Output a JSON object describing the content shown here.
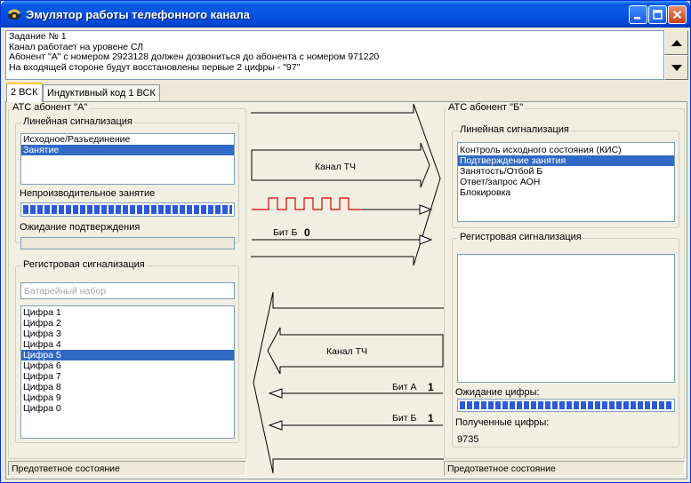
{
  "window": {
    "title": "Эмулятор работы телефонного канала"
  },
  "task": {
    "lines": [
      "Задание № 1",
      "Канал работает на уровене СЛ",
      "Абонент \"А\" с номером 2923128 должен дозвониться до абонента с номером 971220",
      "На входящей стороне будут восстановлены первые 2 цифры - \"97\""
    ]
  },
  "tabs": [
    {
      "label": "2 ВСК",
      "active": true
    },
    {
      "label": "Индуктивный код 1 ВСК",
      "active": false
    }
  ],
  "side_a": {
    "title": "АТС  абонент \"А\"",
    "line_signaling": {
      "title": "Линейная сигнализация",
      "items": [
        "Исходное/Разъединение",
        "Занятие"
      ],
      "selected_index": 1
    },
    "unproductive_label": "Непроизводительное занятие",
    "unproductive_progress": 1.0,
    "waiting_confirm_label": "Ожидание подтверждения",
    "waiting_confirm_progress": 0.0,
    "register_signaling": {
      "title": "Регистровая сигнализация",
      "dial_placeholder": "Батарейный набор",
      "digits": [
        "Цифра 1",
        "Цифра 2",
        "Цифра 3",
        "Цифра 4",
        "Цифра 5",
        "Цифра 6",
        "Цифра 7",
        "Цифра 8",
        "Цифра 9",
        "Цифра 0"
      ],
      "selected_index": 4
    },
    "status": "Предответное состояние"
  },
  "channel": {
    "forward_label": "Канал ТЧ",
    "forward_bit_label": "Бит Б",
    "forward_bit_value": "0",
    "backward_label": "Канал ТЧ",
    "backward_bit_a_label": "Бит А",
    "backward_bit_a_value": "1",
    "backward_bit_b_label": "Бит Б",
    "backward_bit_b_value": "1",
    "signal_color": "#e00000"
  },
  "side_b": {
    "title": "АТС  абонент \"Б\"",
    "line_signaling": {
      "title": "Линейная сигнализация",
      "items": [
        "Контроль исходного состояния (КИС)",
        "Подтверждение занятия",
        "Занятость/Отбой Б",
        "Ответ/запрос АОН",
        "Блокировка"
      ],
      "selected_index": 1
    },
    "register_signaling": {
      "title": "Регистровая сигнализация"
    },
    "waiting_digit_label": "Ожидание цифры:",
    "waiting_digit_progress": 1.0,
    "received_label": "Полученные цифры:",
    "received_digits": "9735",
    "status": "Предответное состояние"
  }
}
